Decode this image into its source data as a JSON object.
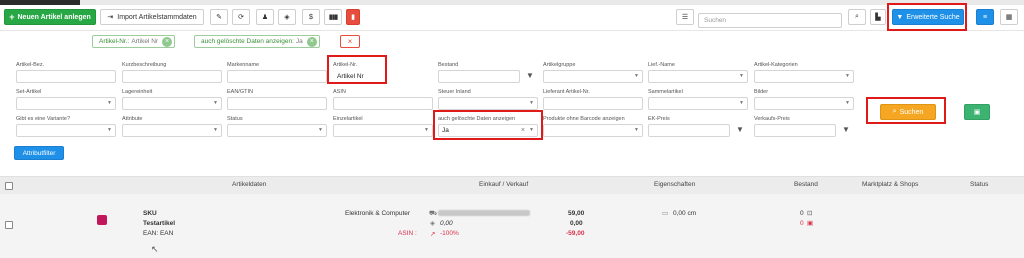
{
  "toolbar": {
    "new_article_label": "Neuen Artikel anlegen",
    "import_label": "Import Artikelstammdaten",
    "dollar_label": "$",
    "search_placeholder": "Suchen",
    "advanced_search_label": "Erweiterte Suche"
  },
  "chips": [
    {
      "key": "Artikel-Nr.:",
      "value": "Artikel Nr"
    },
    {
      "key": "auch gelöschte Daten anzeigen:",
      "value": "Ja"
    }
  ],
  "filters": {
    "row1": [
      {
        "label": "Artikel-Bez.",
        "value": ""
      },
      {
        "label": "Kurzbeschreibung",
        "value": ""
      },
      {
        "label": "Markenname",
        "value": ""
      },
      {
        "label": "Artikel-Nr.",
        "value": "Artikel Nr"
      },
      {
        "label": "Bestand",
        "value": ""
      },
      {
        "label": "Artikelgruppe",
        "value": ""
      },
      {
        "label": "Lief.-Name",
        "value": ""
      },
      {
        "label": "Artikel-Kategorien",
        "value": ""
      }
    ],
    "row2": [
      {
        "label": "Set-Artikel",
        "value": ""
      },
      {
        "label": "Lagereinheit",
        "value": ""
      },
      {
        "label": "EAN/GTIN",
        "value": ""
      },
      {
        "label": "ASIN",
        "value": ""
      },
      {
        "label": "Steuer Inland",
        "value": ""
      },
      {
        "label": "Lieferant Artikel-Nr.",
        "value": ""
      },
      {
        "label": "Sammelartikel",
        "value": ""
      },
      {
        "label": "Bilder",
        "value": ""
      }
    ],
    "row3": [
      {
        "label": "Gibt es eine Variante?",
        "value": ""
      },
      {
        "label": "Attribute",
        "value": ""
      },
      {
        "label": "Status",
        "value": ""
      },
      {
        "label": "Einzelartikel",
        "value": ""
      },
      {
        "label": "auch gelöschte Daten anzeigen",
        "value": "Ja"
      },
      {
        "label": "Produkte ohne Barcode anzeigen",
        "value": ""
      },
      {
        "label": "EK-Preis",
        "value": ""
      },
      {
        "label": "Verkaufs-Preis",
        "value": ""
      }
    ],
    "search_button_label": "Suchen",
    "attribute_filter_label": "Attributfilter"
  },
  "table": {
    "headers": {
      "article_data": "Artikeldaten",
      "purchase_sale": "Einkauf / Verkauf",
      "properties": "Eigenschaften",
      "stock": "Bestand",
      "marketplace": "Marktplatz & Shops",
      "status": "Status"
    },
    "row": {
      "sku": "SKU",
      "name": "Testartikel",
      "ean": "EAN: EAN",
      "category": "Elektronik & Computer",
      "asin_label": "ASIN :",
      "purchase_value": "0,00",
      "margin": "-100%",
      "price_1": "59,00",
      "price_2": "0,00",
      "price_3": "-59,00",
      "dimension": "0,00 cm",
      "stock_1": "0",
      "stock_2": "0"
    }
  },
  "colors": {
    "green": "#28a745",
    "blue": "#1e90e8",
    "orange": "#f5a623",
    "highlight_red": "#e01919"
  }
}
